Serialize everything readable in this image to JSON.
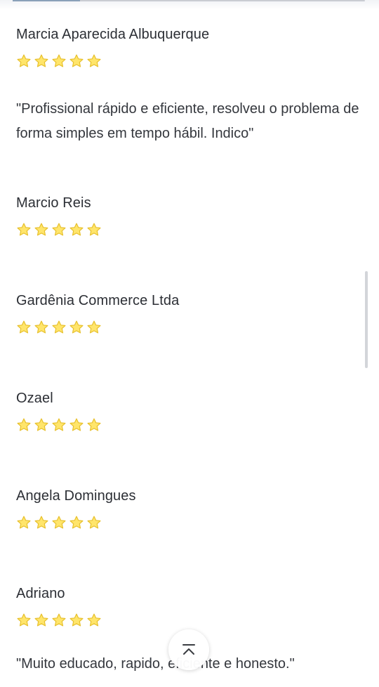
{
  "colors": {
    "star_fill": "#ffe56b",
    "star_stroke": "#e7c02c",
    "text": "#34373d"
  },
  "reviews": [
    {
      "name": "Marcia Aparecida Albuquerque",
      "rating": 5,
      "text": "\"Profissional rápido e eficiente, resolveu o problema de forma simples em tempo hábil. Indico\""
    },
    {
      "name": "Marcio Reis",
      "rating": 5
    },
    {
      "name": "Gardênia Commerce Ltda",
      "rating": 5
    },
    {
      "name": "Ozael",
      "rating": 5
    },
    {
      "name": "Angela Domingues",
      "rating": 5
    },
    {
      "name": "Adriano",
      "rating": 5,
      "text": "\"Muito educado, rapido, eficiente e honesto.\""
    }
  ],
  "icons": {
    "star": "star-icon",
    "back_to_top": "chevron-up-bar-icon"
  }
}
